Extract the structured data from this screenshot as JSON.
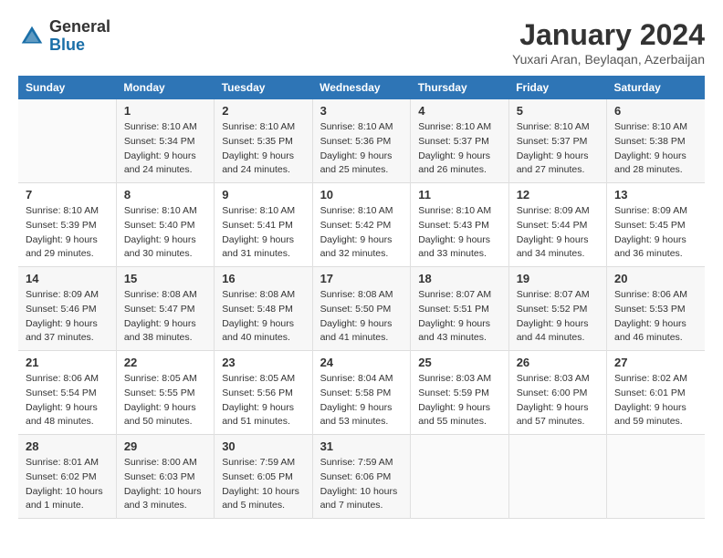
{
  "header": {
    "logo_general": "General",
    "logo_blue": "Blue",
    "month_title": "January 2024",
    "location": "Yuxari Aran, Beylaqan, Azerbaijan"
  },
  "days_of_week": [
    "Sunday",
    "Monday",
    "Tuesday",
    "Wednesday",
    "Thursday",
    "Friday",
    "Saturday"
  ],
  "weeks": [
    [
      {
        "day": "",
        "sunrise": "",
        "sunset": "",
        "daylight": ""
      },
      {
        "day": "1",
        "sunrise": "Sunrise: 8:10 AM",
        "sunset": "Sunset: 5:34 PM",
        "daylight": "Daylight: 9 hours and 24 minutes."
      },
      {
        "day": "2",
        "sunrise": "Sunrise: 8:10 AM",
        "sunset": "Sunset: 5:35 PM",
        "daylight": "Daylight: 9 hours and 24 minutes."
      },
      {
        "day": "3",
        "sunrise": "Sunrise: 8:10 AM",
        "sunset": "Sunset: 5:36 PM",
        "daylight": "Daylight: 9 hours and 25 minutes."
      },
      {
        "day": "4",
        "sunrise": "Sunrise: 8:10 AM",
        "sunset": "Sunset: 5:37 PM",
        "daylight": "Daylight: 9 hours and 26 minutes."
      },
      {
        "day": "5",
        "sunrise": "Sunrise: 8:10 AM",
        "sunset": "Sunset: 5:37 PM",
        "daylight": "Daylight: 9 hours and 27 minutes."
      },
      {
        "day": "6",
        "sunrise": "Sunrise: 8:10 AM",
        "sunset": "Sunset: 5:38 PM",
        "daylight": "Daylight: 9 hours and 28 minutes."
      }
    ],
    [
      {
        "day": "7",
        "sunrise": "Sunrise: 8:10 AM",
        "sunset": "Sunset: 5:39 PM",
        "daylight": "Daylight: 9 hours and 29 minutes."
      },
      {
        "day": "8",
        "sunrise": "Sunrise: 8:10 AM",
        "sunset": "Sunset: 5:40 PM",
        "daylight": "Daylight: 9 hours and 30 minutes."
      },
      {
        "day": "9",
        "sunrise": "Sunrise: 8:10 AM",
        "sunset": "Sunset: 5:41 PM",
        "daylight": "Daylight: 9 hours and 31 minutes."
      },
      {
        "day": "10",
        "sunrise": "Sunrise: 8:10 AM",
        "sunset": "Sunset: 5:42 PM",
        "daylight": "Daylight: 9 hours and 32 minutes."
      },
      {
        "day": "11",
        "sunrise": "Sunrise: 8:10 AM",
        "sunset": "Sunset: 5:43 PM",
        "daylight": "Daylight: 9 hours and 33 minutes."
      },
      {
        "day": "12",
        "sunrise": "Sunrise: 8:09 AM",
        "sunset": "Sunset: 5:44 PM",
        "daylight": "Daylight: 9 hours and 34 minutes."
      },
      {
        "day": "13",
        "sunrise": "Sunrise: 8:09 AM",
        "sunset": "Sunset: 5:45 PM",
        "daylight": "Daylight: 9 hours and 36 minutes."
      }
    ],
    [
      {
        "day": "14",
        "sunrise": "Sunrise: 8:09 AM",
        "sunset": "Sunset: 5:46 PM",
        "daylight": "Daylight: 9 hours and 37 minutes."
      },
      {
        "day": "15",
        "sunrise": "Sunrise: 8:08 AM",
        "sunset": "Sunset: 5:47 PM",
        "daylight": "Daylight: 9 hours and 38 minutes."
      },
      {
        "day": "16",
        "sunrise": "Sunrise: 8:08 AM",
        "sunset": "Sunset: 5:48 PM",
        "daylight": "Daylight: 9 hours and 40 minutes."
      },
      {
        "day": "17",
        "sunrise": "Sunrise: 8:08 AM",
        "sunset": "Sunset: 5:50 PM",
        "daylight": "Daylight: 9 hours and 41 minutes."
      },
      {
        "day": "18",
        "sunrise": "Sunrise: 8:07 AM",
        "sunset": "Sunset: 5:51 PM",
        "daylight": "Daylight: 9 hours and 43 minutes."
      },
      {
        "day": "19",
        "sunrise": "Sunrise: 8:07 AM",
        "sunset": "Sunset: 5:52 PM",
        "daylight": "Daylight: 9 hours and 44 minutes."
      },
      {
        "day": "20",
        "sunrise": "Sunrise: 8:06 AM",
        "sunset": "Sunset: 5:53 PM",
        "daylight": "Daylight: 9 hours and 46 minutes."
      }
    ],
    [
      {
        "day": "21",
        "sunrise": "Sunrise: 8:06 AM",
        "sunset": "Sunset: 5:54 PM",
        "daylight": "Daylight: 9 hours and 48 minutes."
      },
      {
        "day": "22",
        "sunrise": "Sunrise: 8:05 AM",
        "sunset": "Sunset: 5:55 PM",
        "daylight": "Daylight: 9 hours and 50 minutes."
      },
      {
        "day": "23",
        "sunrise": "Sunrise: 8:05 AM",
        "sunset": "Sunset: 5:56 PM",
        "daylight": "Daylight: 9 hours and 51 minutes."
      },
      {
        "day": "24",
        "sunrise": "Sunrise: 8:04 AM",
        "sunset": "Sunset: 5:58 PM",
        "daylight": "Daylight: 9 hours and 53 minutes."
      },
      {
        "day": "25",
        "sunrise": "Sunrise: 8:03 AM",
        "sunset": "Sunset: 5:59 PM",
        "daylight": "Daylight: 9 hours and 55 minutes."
      },
      {
        "day": "26",
        "sunrise": "Sunrise: 8:03 AM",
        "sunset": "Sunset: 6:00 PM",
        "daylight": "Daylight: 9 hours and 57 minutes."
      },
      {
        "day": "27",
        "sunrise": "Sunrise: 8:02 AM",
        "sunset": "Sunset: 6:01 PM",
        "daylight": "Daylight: 9 hours and 59 minutes."
      }
    ],
    [
      {
        "day": "28",
        "sunrise": "Sunrise: 8:01 AM",
        "sunset": "Sunset: 6:02 PM",
        "daylight": "Daylight: 10 hours and 1 minute."
      },
      {
        "day": "29",
        "sunrise": "Sunrise: 8:00 AM",
        "sunset": "Sunset: 6:03 PM",
        "daylight": "Daylight: 10 hours and 3 minutes."
      },
      {
        "day": "30",
        "sunrise": "Sunrise: 7:59 AM",
        "sunset": "Sunset: 6:05 PM",
        "daylight": "Daylight: 10 hours and 5 minutes."
      },
      {
        "day": "31",
        "sunrise": "Sunrise: 7:59 AM",
        "sunset": "Sunset: 6:06 PM",
        "daylight": "Daylight: 10 hours and 7 minutes."
      },
      {
        "day": "",
        "sunrise": "",
        "sunset": "",
        "daylight": ""
      },
      {
        "day": "",
        "sunrise": "",
        "sunset": "",
        "daylight": ""
      },
      {
        "day": "",
        "sunrise": "",
        "sunset": "",
        "daylight": ""
      }
    ]
  ]
}
